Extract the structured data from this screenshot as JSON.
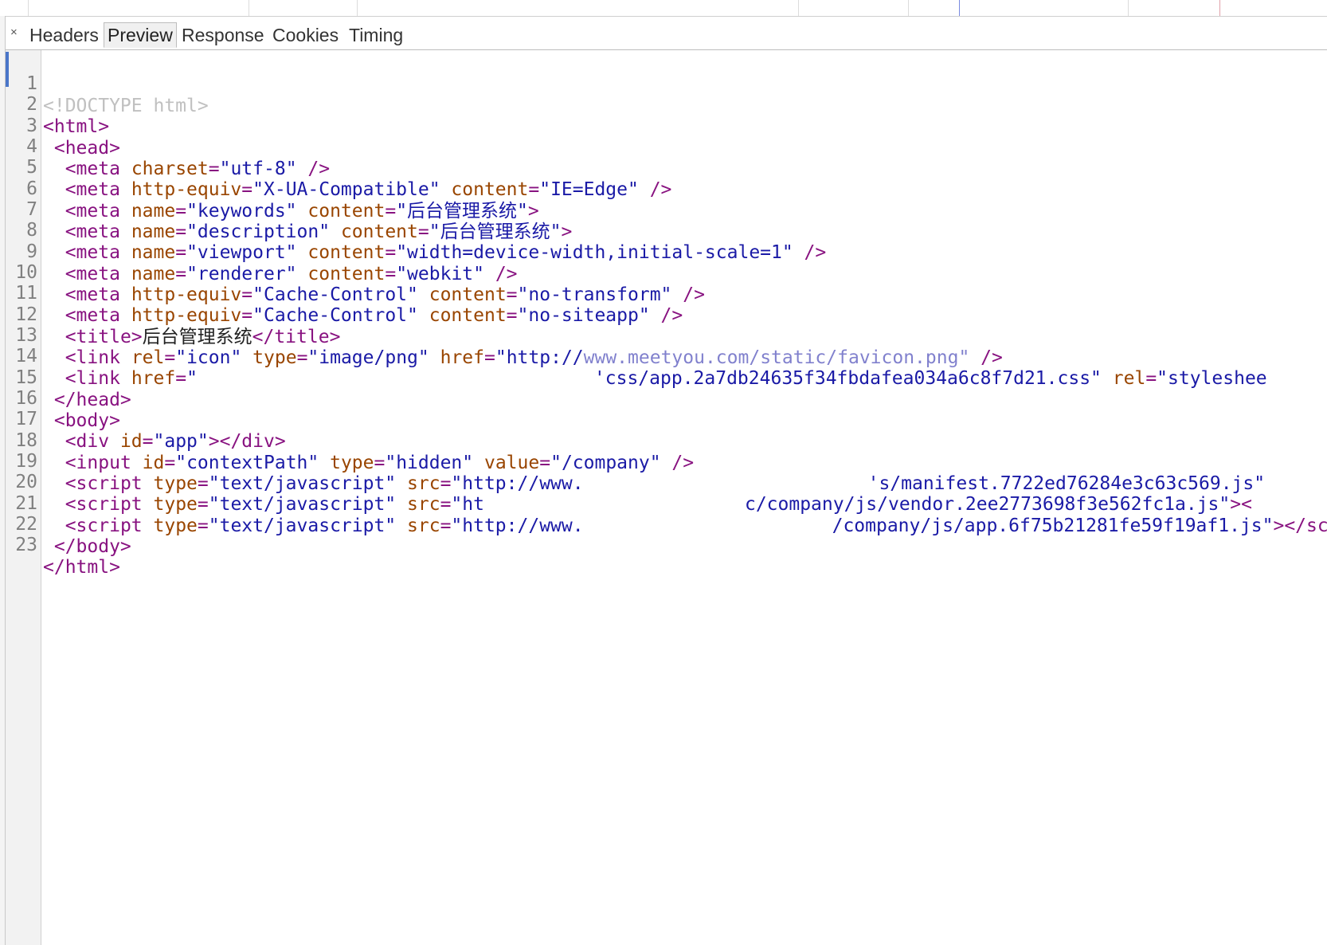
{
  "tabs": {
    "close_glyph": "×",
    "headers": "Headers",
    "preview": "Preview",
    "response": "Response",
    "cookies": "Cookies",
    "timing": "Timing"
  },
  "line_numbers": [
    "1",
    "2",
    "3",
    "4",
    "5",
    "6",
    "7",
    "8",
    "9",
    "10",
    "11",
    "12",
    "13",
    "14",
    "15",
    "16",
    "17",
    "18",
    "19",
    "20",
    "21",
    "22",
    "23"
  ],
  "code": {
    "l1": {
      "doctype": "<!DOCTYPE html>"
    },
    "l2": {
      "open": "<html>"
    },
    "l3": {
      "open": " <head>"
    },
    "l4": {
      "indent": "  ",
      "tag": "<meta",
      "a1": "charset",
      "v1": "\"utf-8\"",
      "close": " />"
    },
    "l5": {
      "indent": "  ",
      "tag": "<meta",
      "a1": "http-equiv",
      "v1": "\"X-UA-Compatible\"",
      "a2": "content",
      "v2": "\"IE=Edge\"",
      "close": " />"
    },
    "l6": {
      "indent": "  ",
      "tag": "<meta",
      "a1": "name",
      "v1": "\"keywords\"",
      "a2": "content",
      "v2": "\"后台管理系统\"",
      "close": ">"
    },
    "l7": {
      "indent": "  ",
      "tag": "<meta",
      "a1": "name",
      "v1": "\"description\"",
      "a2": "content",
      "v2": "\"后台管理系统\"",
      "close": ">"
    },
    "l8": {
      "indent": "  ",
      "tag": "<meta",
      "a1": "name",
      "v1": "\"viewport\"",
      "a2": "content",
      "v2": "\"width=device-width,initial-scale=1\"",
      "close": " />"
    },
    "l9": {
      "indent": "  ",
      "tag": "<meta",
      "a1": "name",
      "v1": "\"renderer\"",
      "a2": "content",
      "v2": "\"webkit\"",
      "close": " />"
    },
    "l10": {
      "indent": "  ",
      "tag": "<meta",
      "a1": "http-equiv",
      "v1": "\"Cache-Control\"",
      "a2": "content",
      "v2": "\"no-transform\"",
      "close": " />"
    },
    "l11": {
      "indent": "  ",
      "tag": "<meta",
      "a1": "http-equiv",
      "v1": "\"Cache-Control\"",
      "a2": "content",
      "v2": "\"no-siteapp\"",
      "close": " />"
    },
    "l12": {
      "indent": "  ",
      "open": "<title>",
      "text": "后台管理系统",
      "close": "</title>"
    },
    "l13": {
      "indent": "  ",
      "tag": "<link",
      "a1": "rel",
      "v1": "\"icon\"",
      "a2": "type",
      "v2": "\"image/png\"",
      "a3": "href",
      "v3a": "\"http://",
      "v3b": "www.meetyou.com/static/favicon.png\"",
      "close": " />"
    },
    "l14": {
      "indent": "  ",
      "tag": "<link",
      "a1": "href",
      "v1a": "\"",
      "v1b": "'css/app.2a7db24635f34fbdafea034a6c8f7d21.css\"",
      "a2": "rel",
      "v2": "\"styleshee"
    },
    "l15": {
      "close": " </head>"
    },
    "l16": {
      "open": " <body>"
    },
    "l17": {
      "indent": "  ",
      "tag": "<div",
      "a1": "id",
      "v1": "\"app\"",
      "close": "></div>"
    },
    "l18": {
      "indent": "  ",
      "tag": "<input",
      "a1": "id",
      "v1": "\"contextPath\"",
      "a2": "type",
      "v2": "\"hidden\"",
      "a3": "value",
      "v3": "\"/company\"",
      "close": " />"
    },
    "l19": {
      "indent": "  ",
      "tag": "<script",
      "a1": "type",
      "v1": "\"text/javascript\"",
      "a2": "src",
      "v2a": "\"http://www.",
      "v2b": "'s/manifest.7722ed76284e3c63c569.js\""
    },
    "l20": {
      "indent": "  ",
      "tag": "<script",
      "a1": "type",
      "v1": "\"text/javascript\"",
      "a2": "src",
      "v2a": "\"ht",
      "v2b": "c/company/js/vendor.2ee2773698f3e562fc1a.js\"",
      "close": "><"
    },
    "l21": {
      "indent": "  ",
      "tag": "<script",
      "a1": "type",
      "v1": "\"text/javascript\"",
      "a2": "src",
      "v2a": "\"http://www.",
      "v2b": "/company/js/app.6f75b21281fe59f19af1.js\"",
      "close": "></sc"
    },
    "l22": {
      "close": " </body>"
    },
    "l23": {
      "close": "</html>"
    }
  }
}
